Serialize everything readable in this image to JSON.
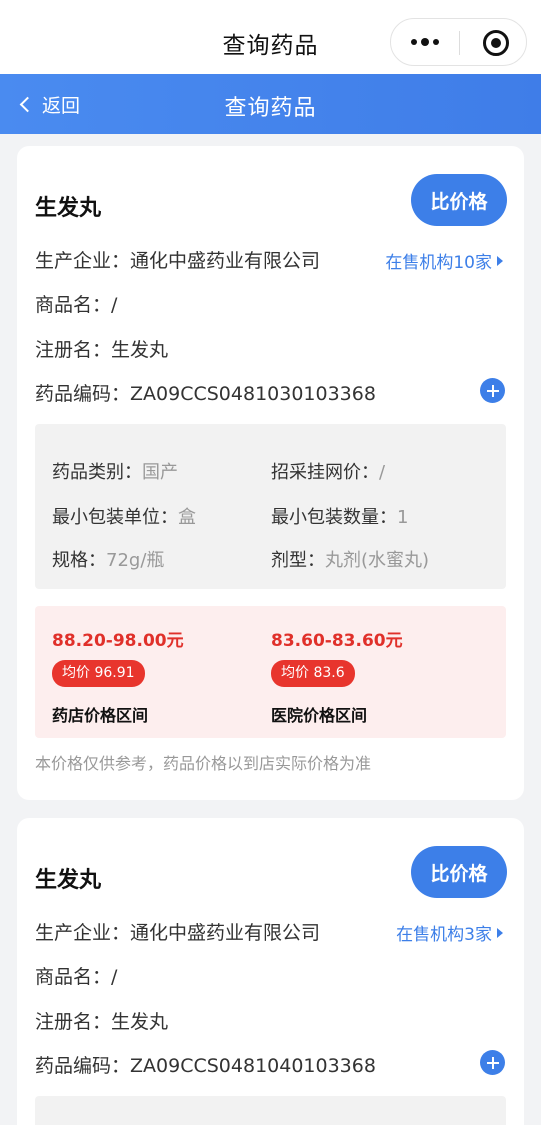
{
  "window": {
    "title": "查询药品"
  },
  "navbar": {
    "back_label": "返回",
    "title": "查询药品"
  },
  "colors": {
    "accent": "#3d7fe8",
    "price_red": "#e0302a",
    "badge_red": "#e8352d",
    "price_bg": "#fdeeee"
  },
  "drugs": [
    {
      "name": "生发丸",
      "compare_label": "比价格",
      "manufacturer_label": "生产企业：",
      "manufacturer": "通化中盛药业有限公司",
      "institutions": "在售机构10家",
      "trade_name_label": "商品名：",
      "trade_name": "/",
      "reg_name_label": "注册名：",
      "reg_name": "生发丸",
      "code_label": "药品编码：",
      "code": "ZA09CCS0481030103368",
      "category_label": "药品类别：",
      "category": "国产",
      "bid_price_label": "招采挂网价：",
      "bid_price": "/",
      "min_unit_label": "最小包装单位：",
      "min_unit": "盒",
      "min_qty_label": "最小包装数量：",
      "min_qty": "1",
      "spec_label": "规格：",
      "spec": "72g/瓶",
      "form_label": "剂型：",
      "form": "丸剂(水蜜丸)",
      "pharmacy_range": "88.20-98.00元",
      "pharmacy_avg": "均价 96.91",
      "pharmacy_label": "药店价格区间",
      "hospital_range": "83.60-83.60元",
      "hospital_avg": "均价 83.6",
      "hospital_label": "医院价格区间",
      "note": "本价格仅供参考，药品价格以到店实际价格为准"
    },
    {
      "name": "生发丸",
      "compare_label": "比价格",
      "manufacturer_label": "生产企业：",
      "manufacturer": "通化中盛药业有限公司",
      "institutions": "在售机构3家",
      "trade_name_label": "商品名：",
      "trade_name": "/",
      "reg_name_label": "注册名：",
      "reg_name": "生发丸",
      "code_label": "药品编码：",
      "code": "ZA09CCS0481040103368"
    }
  ]
}
